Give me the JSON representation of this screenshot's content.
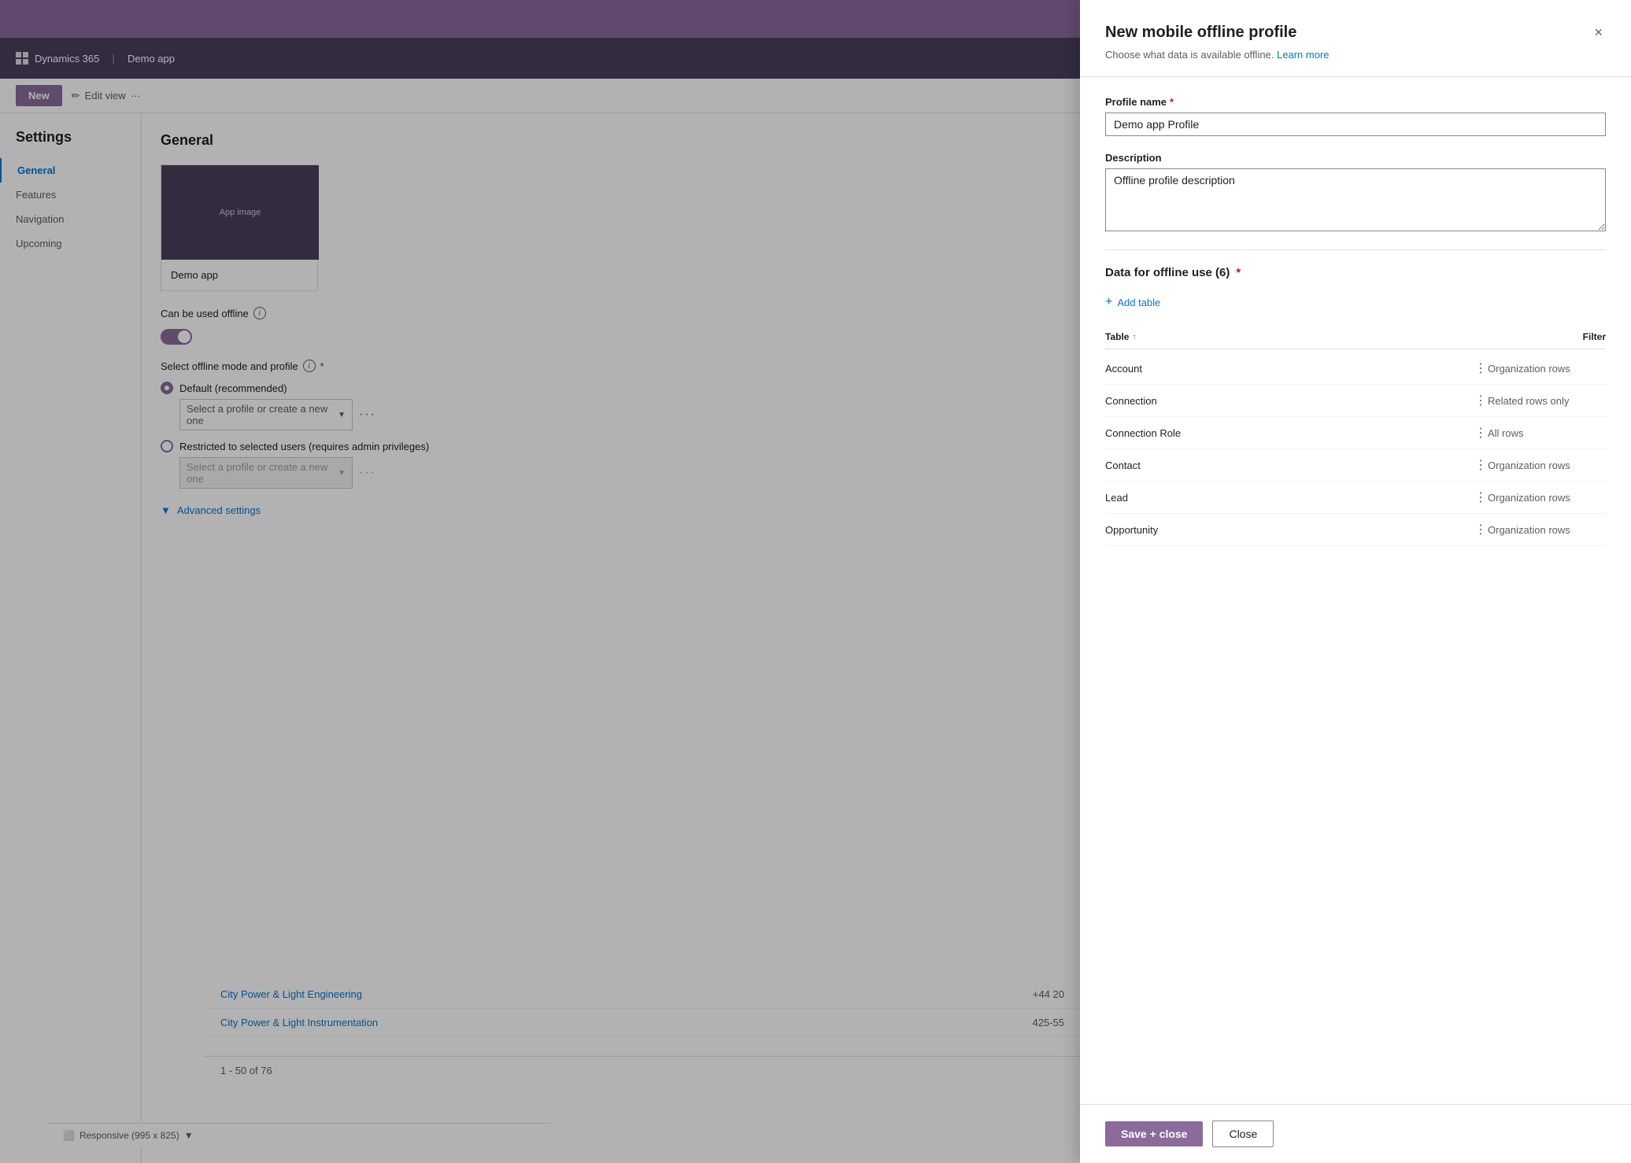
{
  "app": {
    "top_bar_color": "#8a6b9c",
    "nav_bar_color": "#4a3f5c",
    "logo_label": "Dynamics 365",
    "app_name": "Demo app"
  },
  "toolbar": {
    "edit_view_label": "Edit view",
    "new_button_label": "New"
  },
  "settings": {
    "title": "Settings",
    "nav_items": [
      {
        "label": "General",
        "active": true
      },
      {
        "label": "Features",
        "active": false
      },
      {
        "label": "Navigation",
        "active": false
      },
      {
        "label": "Upcoming",
        "active": false
      }
    ]
  },
  "general": {
    "title": "General",
    "app_card_name": "Demo app",
    "offline_label": "Can be used offline",
    "select_mode_label": "Select offline mode and profile",
    "default_option_label": "Default (recommended)",
    "default_placeholder": "Select a profile or create a new one",
    "restricted_option_label": "Restricted to selected users (requires admin privileges)",
    "restricted_placeholder": "Select a profile or create a new one",
    "advanced_settings_label": "Advanced settings"
  },
  "data_rows": [
    {
      "link": "City Power & Light Engineering",
      "value": "+44 20"
    },
    {
      "link": "City Power & Light Instrumentation",
      "value": "425-55"
    }
  ],
  "pagination": {
    "label": "1 - 50 of 76"
  },
  "responsive": {
    "label": "Responsive (995 x 825)"
  },
  "panel": {
    "title": "New mobile offline profile",
    "subtitle": "Choose what data is available offline.",
    "learn_more_label": "Learn more",
    "close_icon": "×",
    "profile_name_label": "Profile name",
    "profile_name_required": true,
    "profile_name_value": "Demo app Profile",
    "description_label": "Description",
    "description_value": "Offline profile description",
    "data_section_title": "Data for offline use (6)",
    "data_section_required": true,
    "add_table_label": "Add table",
    "table_header_table": "Table",
    "table_header_filter": "Filter",
    "tables": [
      {
        "name": "Account",
        "filter": "Organization rows"
      },
      {
        "name": "Connection",
        "filter": "Related rows only"
      },
      {
        "name": "Connection Role",
        "filter": "All rows"
      },
      {
        "name": "Contact",
        "filter": "Organization rows"
      },
      {
        "name": "Lead",
        "filter": "Organization rows"
      },
      {
        "name": "Opportunity",
        "filter": "Organization rows"
      }
    ],
    "save_close_label": "Save + close",
    "close_label": "Close"
  }
}
